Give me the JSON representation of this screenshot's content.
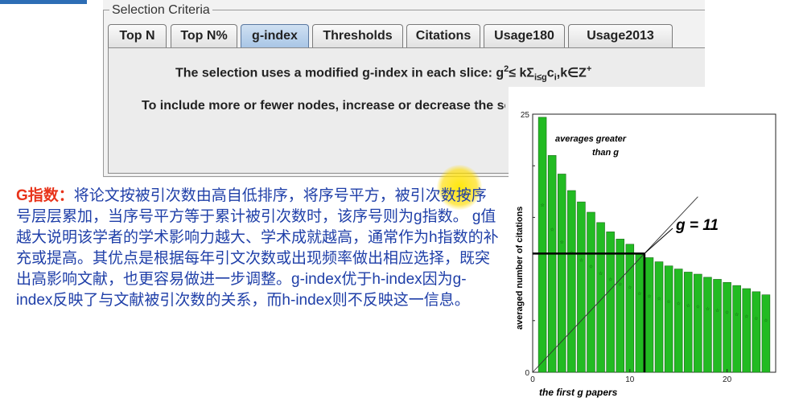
{
  "panel": {
    "group_title": "Selection Criteria",
    "tabs": [
      {
        "label": "Top N",
        "active": false
      },
      {
        "label": "Top N%",
        "active": false
      },
      {
        "label": "g-index",
        "active": true
      },
      {
        "label": "Thresholds",
        "active": false
      },
      {
        "label": "Citations",
        "active": false
      },
      {
        "label": "Usage180",
        "active": false
      },
      {
        "label": "Usage2013",
        "active": false
      }
    ],
    "desc_main": "The selection uses a modified g-index in each slice: g",
    "formula": {
      "sup1": "2",
      "le_k": "≤ kΣ",
      "sub1": "i≤g",
      "c": "c",
      "sub2": "i",
      "tail": ",k∈Z",
      "sup2": "+"
    },
    "desc_second": "To include more or fewer nodes, increase or decrease the scaling factor k."
  },
  "explanation": {
    "heading": "G指数：",
    "body": "将论文按被引次数由高自低排序，将序号平方，被引次数按序号层层累加，当序号平方等于累计被引次数时，该序号则为g指数。 g值越大说明该学者的学术影响力越大、学术成就越高，通常作为h指数的补充或提高。其优点是根据每年引文次数或出现频率做出相应选择，既突出高影响文献，也更容易做进一步调整。g-index优于h-index因为g-index反映了与文献被引次数的关系，而h-index则不反映这一信息。"
  },
  "chart_data": {
    "type": "bar",
    "xlabel": "the first g papers",
    "ylabel": "averaged number of citations",
    "x_ticks": [
      0,
      10,
      20
    ],
    "y_ticks": [
      0,
      25
    ],
    "xlim": [
      0,
      25
    ],
    "ylim": [
      0,
      25
    ],
    "bar_x": [
      1,
      2,
      3,
      4,
      5,
      6,
      7,
      8,
      9,
      10,
      11,
      12,
      13,
      14,
      15,
      16,
      17,
      18,
      19,
      20,
      21,
      22,
      23,
      24
    ],
    "values": [
      24.7,
      21.0,
      19.2,
      17.6,
      16.5,
      15.5,
      14.5,
      13.6,
      12.9,
      12.4,
      11.5,
      11.1,
      10.7,
      10.3,
      10.0,
      9.7,
      9.5,
      9.2,
      9.0,
      8.7,
      8.4,
      8.1,
      7.8,
      7.5
    ],
    "annotation_top": "averages greater",
    "annotation_top2": "than g",
    "annotation_g": "g = 11",
    "g_value": 11,
    "bar_color": "#22bb22",
    "bar_stroke": "#1a6b1a"
  }
}
